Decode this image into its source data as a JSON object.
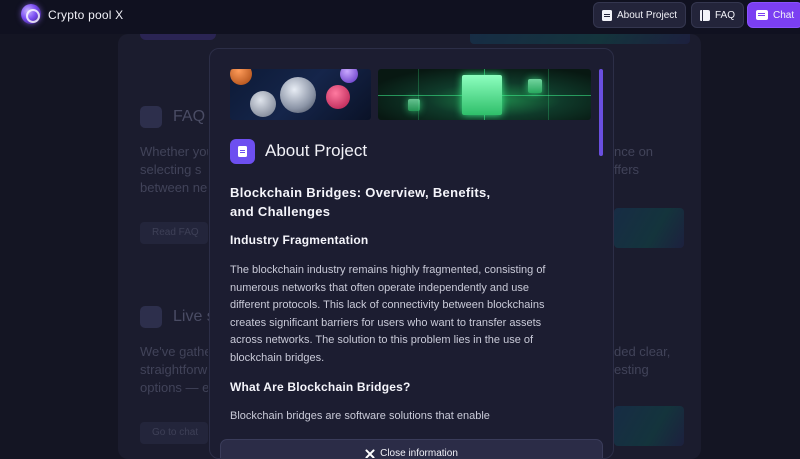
{
  "header": {
    "brand": "Crypto pool X",
    "nav": {
      "about": "About Project",
      "faq": "FAQ",
      "chat": "Chat"
    }
  },
  "background": {
    "faq_heading": "FAQ",
    "faq_text_left": [
      "Whether you",
      "selecting s",
      "between ne"
    ],
    "faq_text_right": [
      "nce on",
      "ffers"
    ],
    "faq_button": "Read FAQ",
    "live_heading": "Live s",
    "live_text_left": [
      "We've gathe",
      "straightforw",
      "options — e"
    ],
    "live_text_right": [
      "ded clear,",
      "esting"
    ],
    "live_button": "Go to chat"
  },
  "modal": {
    "title": "About Project",
    "article_title_line1": "Blockchain Bridges: Overview, Benefits,",
    "article_title_line2": "and Challenges",
    "section1_heading": "Industry Fragmentation",
    "section1_lines": [
      "The blockchain industry remains highly fragmented, consisting of",
      "numerous networks that often operate independently and use",
      "different protocols. This lack of connectivity between blockchains",
      "creates significant barriers for users who want to transfer assets",
      "across networks. The solution to this problem lies in the use of",
      "blockchain bridges."
    ],
    "section2_heading": "What Are Blockchain Bridges?",
    "section2_line": "Blockchain bridges are software solutions that enable",
    "close_label": "Close information"
  },
  "colors": {
    "accent": "#7b3ff2",
    "modal_bg": "#1c1d31",
    "page_bg": "#141523"
  },
  "icons": {
    "logo": "crypto-pool-logo",
    "about": "document-icon",
    "faq": "book-icon",
    "chat": "chat-icon",
    "close": "close-icon"
  }
}
